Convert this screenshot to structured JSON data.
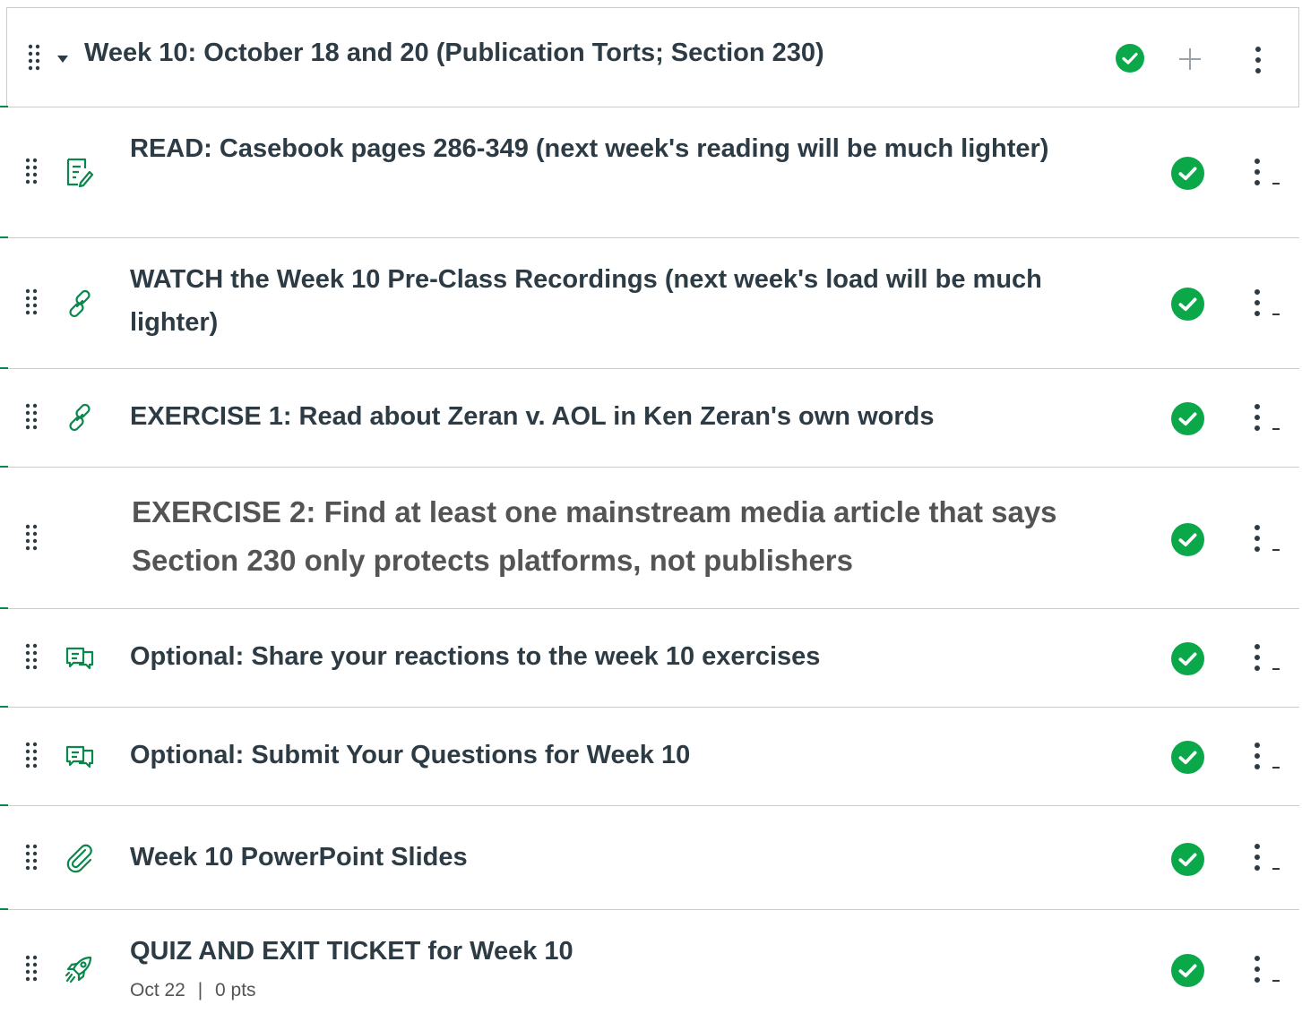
{
  "module": {
    "title": "Week 10: October 18 and 20 (Publication Torts; Section 230)",
    "status_icon": "check-circle-icon",
    "add_icon": "plus-icon",
    "menu_icon": "kebab-icon"
  },
  "colors": {
    "accent_green": "#0ba84a",
    "icon_green": "#0b874b",
    "text_dark": "#2d3b45",
    "text_gray": "#545454",
    "border": "#c7cdd1"
  },
  "items": [
    {
      "type_icon": "page-icon",
      "title": "READ: Casebook pages 286-349 (next week's reading will be much lighter)"
    },
    {
      "type_icon": "link-icon",
      "title": "WATCH the Week 10 Pre-Class Recordings (next week's load will be much lighter)"
    },
    {
      "type_icon": "link-icon",
      "title": "EXERCISE 1: Read about Zeran v. AOL in Ken Zeran's own words"
    },
    {
      "type_icon": "",
      "title": "EXERCISE 2: Find at least one mainstream media article that says Section 230 only protects platforms, not publishers"
    },
    {
      "type_icon": "discussion-icon",
      "title": "Optional: Share your reactions to the week 10 exercises"
    },
    {
      "type_icon": "discussion-icon",
      "title": "Optional: Submit Your Questions for Week 10"
    },
    {
      "type_icon": "attachment-icon",
      "title": "Week 10 PowerPoint Slides"
    },
    {
      "type_icon": "quiz-icon",
      "title": "QUIZ AND EXIT TICKET for Week 10",
      "due": "Oct 22",
      "separator": "|",
      "points": "0 pts"
    }
  ]
}
